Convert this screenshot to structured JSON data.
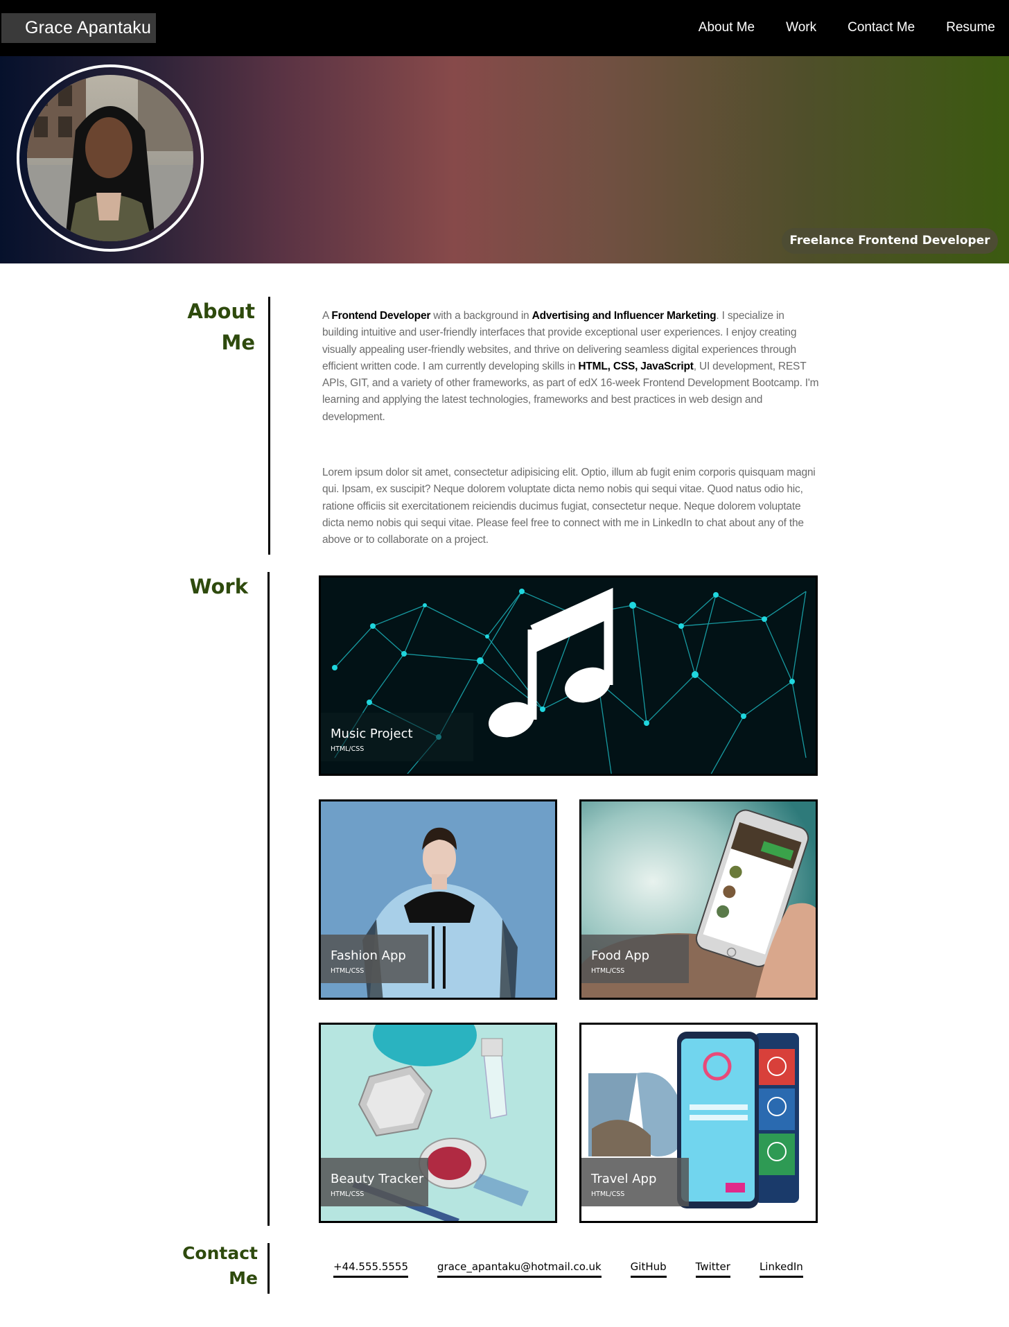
{
  "header": {
    "brand": "Grace Apantaku",
    "nav": [
      "About Me",
      "Work",
      "Contact Me",
      "Resume"
    ]
  },
  "hero": {
    "tagline": "Freelance Frontend Developer"
  },
  "about": {
    "title_line1": "About",
    "title_line2": "Me",
    "p1_a": "A ",
    "p1_b": "Frontend Developer",
    "p1_c": " with a background in ",
    "p1_d": "Advertising and Influencer Marketing",
    "p1_e": ". I specialize in building intuitive and user-friendly interfaces that provide exceptional user experiences. I enjoy creating visually appealing user-friendly websites, and thrive on delivering seamless digital experiences through efficient written code. I am currently developing skills in ",
    "p1_f": "HTML, CSS, JavaScript",
    "p1_g": ", UI development, REST APIs, GIT, and a variety of other frameworks, as part of edX 16-week Frontend Development Bootcamp. I'm learning and applying the latest technologies, frameworks and best practices in web design and development.",
    "p2": "Lorem ipsum dolor sit amet, consectetur adipisicing elit. Optio, illum ab fugit enim corporis quisquam magni qui. Ipsam, ex suscipit? Neque dolorem voluptate dicta nemo nobis qui sequi vitae. Quod natus odio hic, ratione officiis sit exercitationem reiciendis ducimus fugiat, consectetur neque. Neque dolorem voluptate dicta nemo nobis qui sequi vitae. Please feel free to connect with me in LinkedIn to chat about any of the above or to collaborate on a project."
  },
  "work": {
    "title": "Work",
    "projects": [
      {
        "name": "Music Project",
        "tech": "HTML/CSS"
      },
      {
        "name": "Fashion App",
        "tech": "HTML/CSS"
      },
      {
        "name": "Food App",
        "tech": "HTML/CSS"
      },
      {
        "name": "Beauty Tracker",
        "tech": "HTML/CSS"
      },
      {
        "name": "Travel App",
        "tech": "HTML/CSS"
      }
    ]
  },
  "contact": {
    "title_line1": "Contact",
    "title_line2": "Me",
    "links": [
      "+44.555.5555",
      "grace_apantaku@hotmail.co.uk",
      "GitHub",
      "Twitter",
      "LinkedIn"
    ]
  },
  "colors": {
    "accent_green": "#2e4a0d",
    "header_bg": "#000000"
  }
}
